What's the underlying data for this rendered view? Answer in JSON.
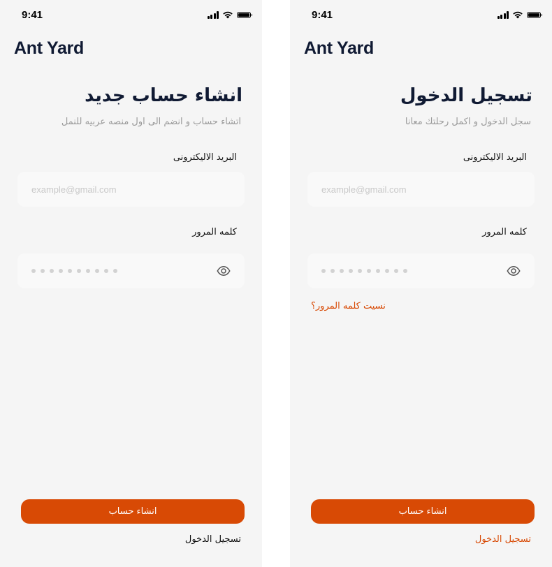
{
  "colors": {
    "accent": "#d84a05",
    "background": "#f5f5f5",
    "input_background": "#f9f9f9",
    "title": "#101a33",
    "muted": "#9a9a9a"
  },
  "status_bar": {
    "time": "9:41",
    "icons": [
      "signal-icon",
      "wifi-icon",
      "battery-icon"
    ]
  },
  "signup": {
    "brand": "Ant Yard",
    "title": "انشاء حساب جديد",
    "subtitle": "اتشاء حساب و انضم الى اول منصه عربيه للنمل",
    "email_label": "البريد الاليكترونى",
    "email_placeholder": "example@gmail.com",
    "password_label": "كلمه المرور",
    "password_mask_length": 10,
    "password_toggle_icon": "eye-icon",
    "primary_button": "انشاء حساب",
    "secondary_link": "تسجيل الدخول"
  },
  "login": {
    "brand": "Ant Yard",
    "title": "تسجيل الدخول",
    "subtitle": "سجل الدخول و اكمل رحلتك معانا",
    "email_label": "البريد الاليكترونى",
    "email_placeholder": "example@gmail.com",
    "password_label": "كلمه المرور",
    "password_mask_length": 10,
    "password_toggle_icon": "eye-icon",
    "forgot_password": "نسيت كلمه المرور؟",
    "primary_button": "انشاء حساب",
    "secondary_link": "تسجيل الدخول"
  }
}
